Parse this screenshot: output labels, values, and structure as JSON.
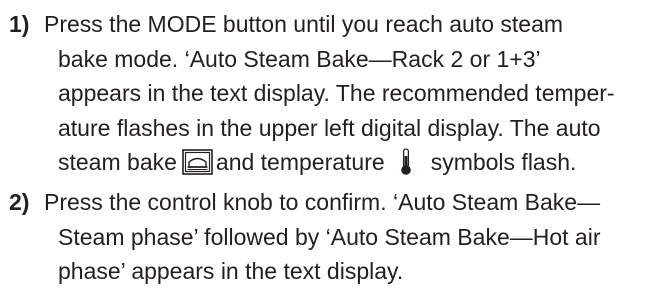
{
  "steps": [
    {
      "number": "1)",
      "lines": [
        "Press the MODE button until you reach auto steam",
        "bake mode. ‘Auto Steam Bake—Rack 2 or 1+3’",
        "appears in the text display. The recommended temper-",
        "ature flashes in the upper left digital display. The auto"
      ],
      "last_line": {
        "part1": "steam bake",
        "part2": "and temperature",
        "part3": "symbols flash."
      },
      "icons": [
        "auto-steam-bake-icon",
        "thermometer-icon"
      ]
    },
    {
      "number": "2)",
      "lines": [
        "Press the control knob to confirm. ‘Auto Steam Bake—",
        "Steam phase’ followed by ‘Auto Steam Bake—Hot air",
        "phase’ appears in the text display."
      ]
    }
  ]
}
